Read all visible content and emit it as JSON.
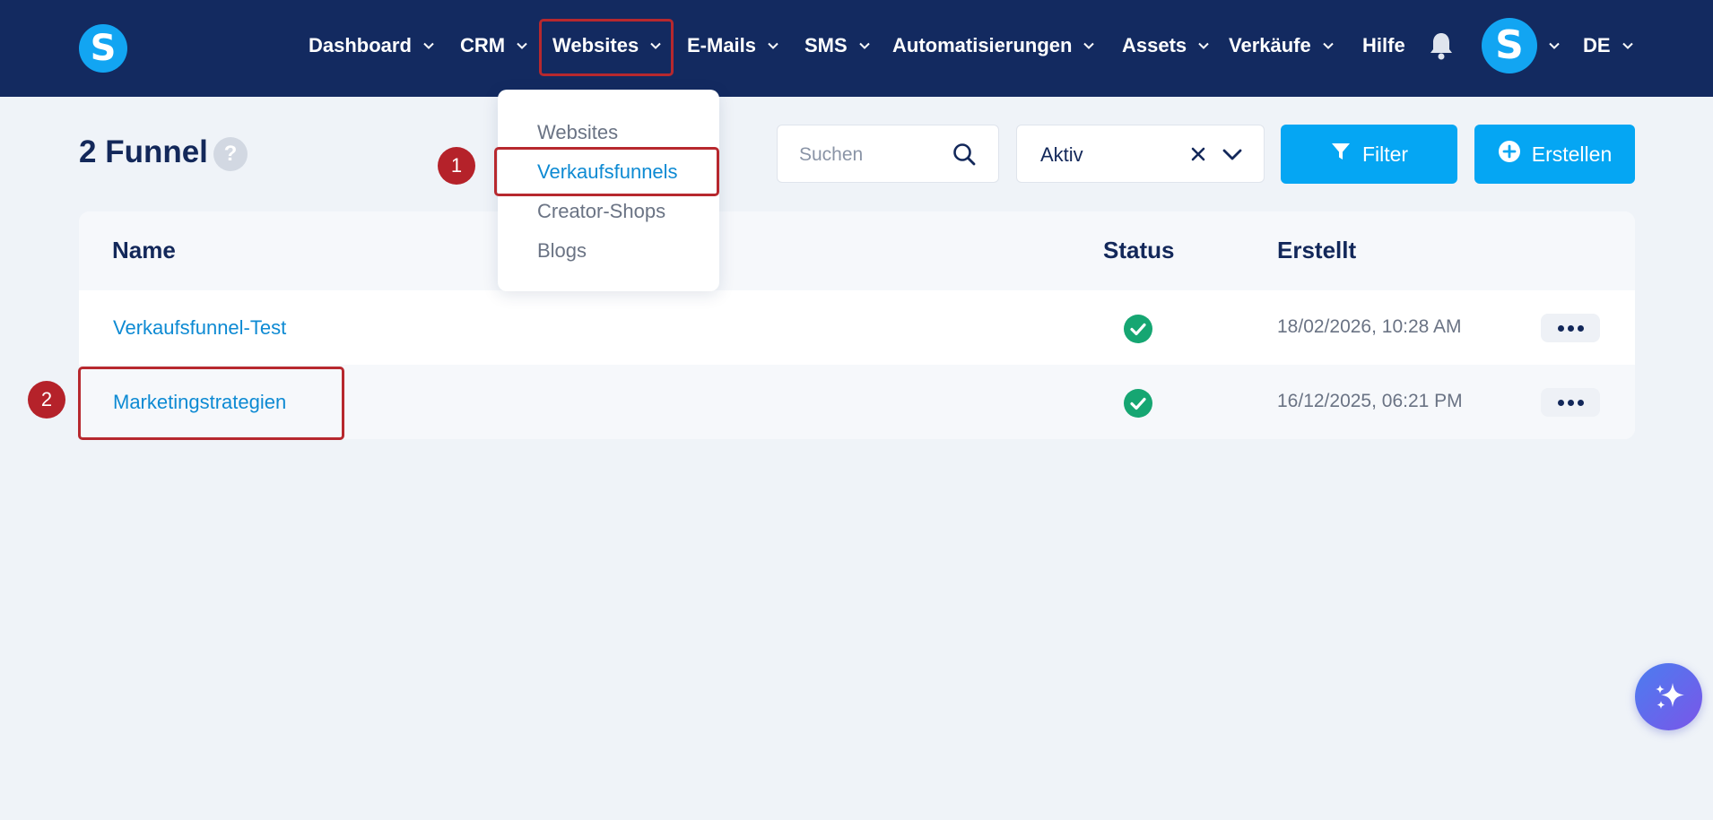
{
  "app": {
    "logo_letter": "S"
  },
  "nav": {
    "items": [
      {
        "label": "Dashboard"
      },
      {
        "label": "CRM"
      },
      {
        "label": "Websites"
      },
      {
        "label": "E-Mails"
      },
      {
        "label": "SMS"
      },
      {
        "label": "Automatisierungen"
      },
      {
        "label": "Assets"
      },
      {
        "label": "Verkäufe"
      },
      {
        "label": "Hilfe"
      }
    ],
    "avatar_letter": "S",
    "language": "DE"
  },
  "dropdown": {
    "items": [
      {
        "label": "Websites"
      },
      {
        "label": "Verkaufsfunnels"
      },
      {
        "label": "Creator-Shops"
      },
      {
        "label": "Blogs"
      }
    ]
  },
  "page": {
    "title": "2 Funnel",
    "help": "?"
  },
  "toolbar": {
    "search_placeholder": "Suchen",
    "status_filter_value": "Aktiv",
    "filter_label": "Filter",
    "create_label": "Erstellen"
  },
  "table": {
    "headers": {
      "name": "Name",
      "status": "Status",
      "created": "Erstellt"
    },
    "rows": [
      {
        "name": "Verkaufsfunnel-Test",
        "status": "active",
        "created": "18/02/2026, 10:28 AM"
      },
      {
        "name": "Marketingstrategien",
        "status": "active",
        "created": "16/12/2025, 06:21 PM"
      }
    ]
  },
  "annotations": {
    "step1": "1",
    "step2": "2"
  },
  "colors": {
    "nav_bg": "#132a60",
    "accent": "#05a6f3",
    "highlight": "#b7282e",
    "status_ok": "#16a672"
  }
}
